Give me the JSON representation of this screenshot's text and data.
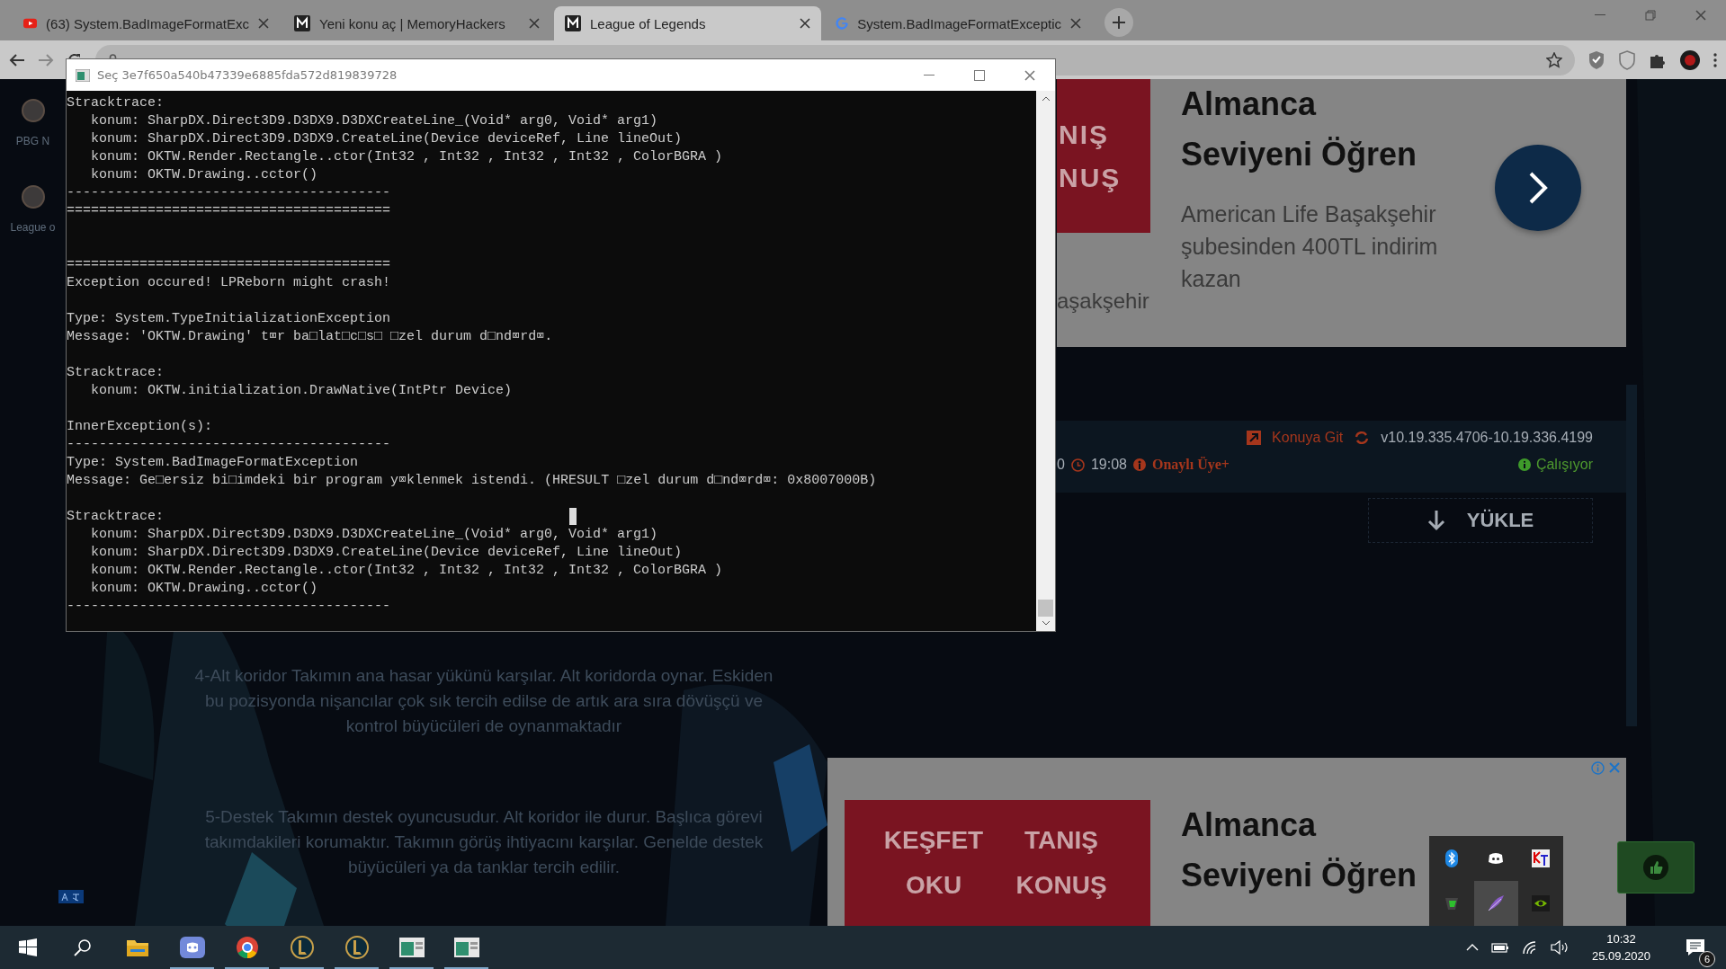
{
  "browser": {
    "tabs": [
      {
        "title": "(63) System.BadImageFormatExc",
        "kind": "video",
        "selected": false
      },
      {
        "title": "Yeni konu aç | MemoryHackers",
        "kind": "monogram",
        "selected": false
      },
      {
        "title": "League of Legends",
        "kind": "monogram",
        "selected": true
      },
      {
        "title": "System.BadImageFormatExceptic",
        "kind": "search",
        "selected": false
      }
    ]
  },
  "console": {
    "title": "Seç 3e7f650a540b47339e6885fda572d819839728",
    "lines": [
      {
        "kind": "text",
        "text": "Stracktrace:"
      },
      {
        "kind": "text",
        "text": "   konum: SharpDX.Direct3D9.D3DX9.D3DXCreateLine_(Void* arg0, Void* arg1)"
      },
      {
        "kind": "text",
        "text": "   konum: SharpDX.Direct3D9.D3DX9.CreateLine(Device deviceRef, Line lineOut)"
      },
      {
        "kind": "text",
        "text": "   konum: OKTW.Render.Rectangle..ctor(Int32 , Int32 , Int32 , Int32 , ColorBGRA )"
      },
      {
        "kind": "text",
        "text": "   konum: OKTW.Drawing..cctor()"
      },
      {
        "kind": "text",
        "text": "----------------------------------------"
      },
      {
        "kind": "text",
        "text": "========================================"
      },
      {
        "kind": "blank"
      },
      {
        "kind": "blank"
      },
      {
        "kind": "text",
        "text": "========================================"
      },
      {
        "kind": "text",
        "text": "Exception occured! LPReborn might crash!"
      },
      {
        "kind": "blank"
      },
      {
        "kind": "text",
        "text": "Type: System.TypeInitializationException"
      },
      {
        "kind": "text",
        "text": "Message: 'OKTW.Drawing' t⌧r ba□lat□c□s□ □zel durum d□nd⌧rd⌧."
      },
      {
        "kind": "blank"
      },
      {
        "kind": "text",
        "text": "Stracktrace:"
      },
      {
        "kind": "text",
        "text": "   konum: OKTW.initialization.DrawNative(IntPtr Device)"
      },
      {
        "kind": "blank"
      },
      {
        "kind": "text",
        "text": "InnerException(s):"
      },
      {
        "kind": "text",
        "text": "----------------------------------------"
      },
      {
        "kind": "text",
        "text": "Type: System.BadImageFormatException"
      },
      {
        "kind": "text",
        "text": "Message: Ge□ersiz bi□imdeki bir program y⌧klenmek istendi. (HRESULT □zel durum d□nd⌧rd⌧: 0x8007000B)"
      },
      {
        "kind": "blank"
      },
      {
        "kind": "text",
        "text": "Stracktrace:"
      },
      {
        "kind": "text",
        "text": "   konum: SharpDX.Direct3D9.D3DX9.D3DXCreateLine_(Void* arg0, Void* arg1)"
      },
      {
        "kind": "text",
        "text": "   konum: SharpDX.Direct3D9.D3DX9.CreateLine(Device deviceRef, Line lineOut)"
      },
      {
        "kind": "text",
        "text": "   konum: OKTW.Render.Rectangle..ctor(Int32 , Int32 , Int32 , Int32 , ColorBGRA )"
      },
      {
        "kind": "text",
        "text": "   konum: OKTW.Drawing..cctor()"
      },
      {
        "kind": "text",
        "text": "----------------------------------------"
      }
    ]
  },
  "sidebar": {
    "items": [
      {
        "label": "PBG N"
      },
      {
        "label": "League o"
      }
    ]
  },
  "ad_top": {
    "image_texts": [
      "NIŞ",
      "NUŞ"
    ],
    "caption": "aşakşehir",
    "title_lines": [
      "Almanca",
      "Seviyeni Öğren"
    ],
    "description_lines": [
      "American Life Başakşehir",
      "şubesinden 400TL indirim",
      "kazan"
    ]
  },
  "thread_meta": {
    "link": "Konuya Git",
    "version": "v10.19.335.4706-10.19.336.4199",
    "date": "0",
    "time": "19:08",
    "rank": "Onaylı Üye+",
    "status": "Çalışıyor",
    "download": "YÜKLE"
  },
  "article": {
    "paragraphs": [
      [
        "4-Alt koridor Takımın ana hasar yükünü karşılar. Alt koridorda oynar. Eskiden",
        "bu pozisyonda nişancılar çok sık tercih edilse de artık ara sıra dövüşçü ve",
        "kontrol büyücüleri de oynanmaktadır"
      ],
      [
        "5-Destek Takımın destek oyuncusudur. Alt koridor ile durur. Başlıca görevi",
        "takımdakileri korumaktır. Takımın görüş ihtiyacını karşılar. Genelde destek",
        "büyücüleri ya da tanklar tercih edilir."
      ]
    ]
  },
  "ad_bottom": {
    "image_texts": [
      "KEŞFET",
      "TANIŞ",
      "OKU",
      "KONUŞ"
    ],
    "title_lines": [
      "Almanca",
      "Seviyeni Öğren"
    ]
  },
  "taskbar": {
    "apps": [
      {
        "kind": "explorer",
        "running": false
      },
      {
        "kind": "discord",
        "running": true
      },
      {
        "kind": "chrome",
        "running": true
      },
      {
        "kind": "game",
        "running": true
      },
      {
        "kind": "game",
        "running": true
      },
      {
        "kind": "window",
        "running": true
      },
      {
        "kind": "window",
        "running": true
      }
    ],
    "tray_popup": [
      {
        "kind": "bluetooth"
      },
      {
        "kind": "discord"
      },
      {
        "kind": "kt"
      },
      {
        "kind": "shield"
      },
      {
        "kind": "feather"
      },
      {
        "kind": "gpu"
      }
    ],
    "time": "10:32",
    "date": "25.09.2020",
    "notifications": "6"
  }
}
